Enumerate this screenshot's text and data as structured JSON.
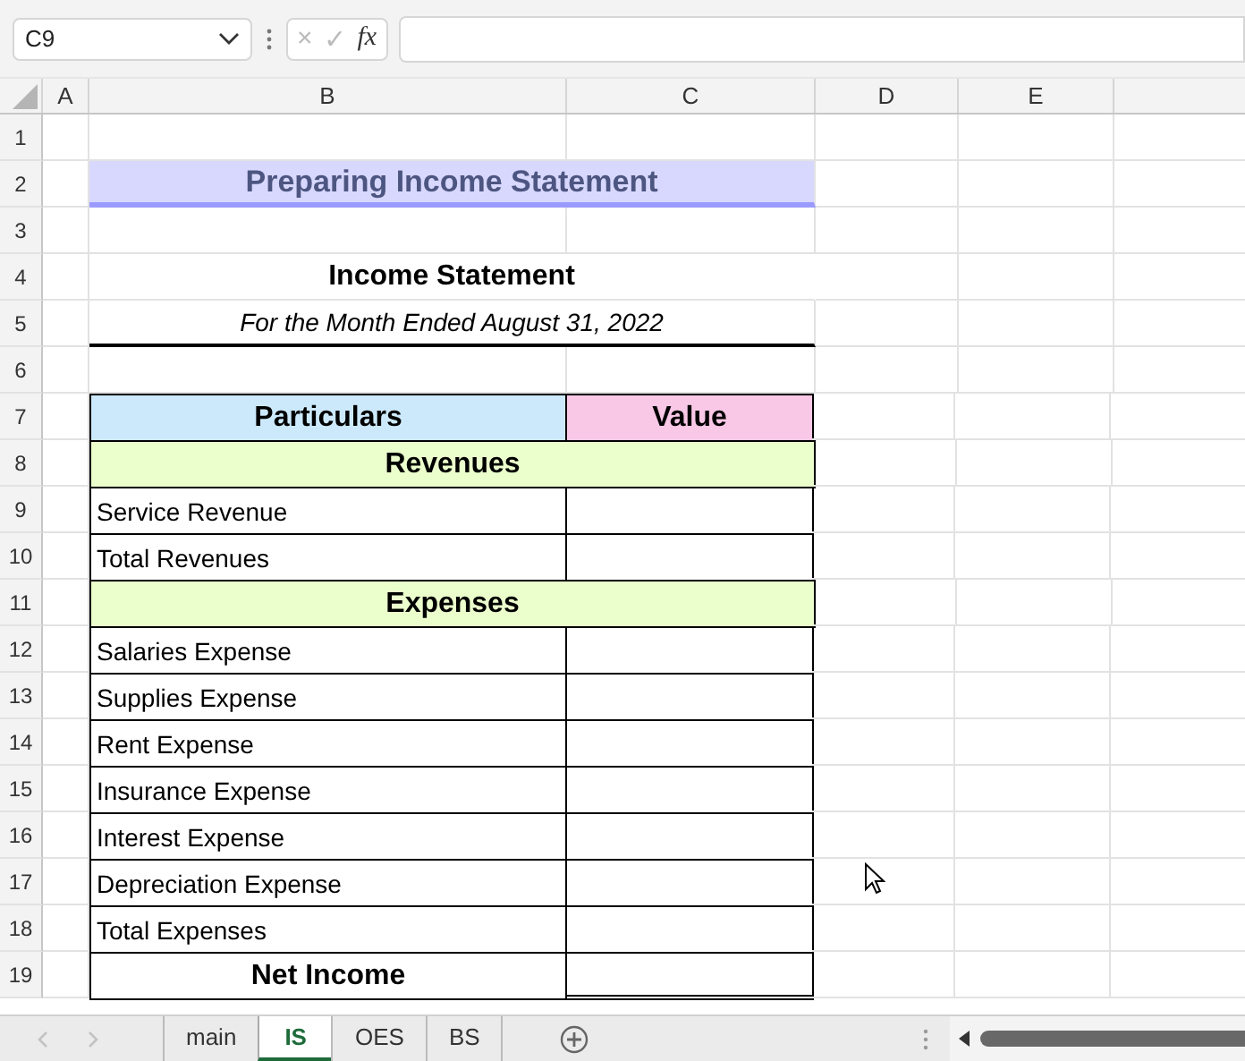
{
  "name_box": "C9",
  "formula_bar": {
    "cancel": "×",
    "enter": "✓",
    "function": "fx"
  },
  "columns": [
    "A",
    "B",
    "C",
    "D",
    "E"
  ],
  "rows": [
    {
      "row": "1",
      "kind": "blank"
    },
    {
      "row": "2",
      "kind": "title",
      "text": "Preparing Income Statement"
    },
    {
      "row": "3",
      "kind": "blank"
    },
    {
      "row": "4",
      "kind": "heading",
      "text": "Income Statement"
    },
    {
      "row": "5",
      "kind": "subheading",
      "text": "For the Month Ended August 31, 2022"
    },
    {
      "row": "6",
      "kind": "blank"
    },
    {
      "row": "7",
      "kind": "table_header",
      "particulars": "Particulars",
      "value": "Value"
    },
    {
      "row": "8",
      "kind": "section",
      "text": "Revenues"
    },
    {
      "row": "9",
      "kind": "item",
      "text": "Service Revenue"
    },
    {
      "row": "10",
      "kind": "item",
      "text": "Total Revenues"
    },
    {
      "row": "11",
      "kind": "section",
      "text": "Expenses"
    },
    {
      "row": "12",
      "kind": "item",
      "text": "Salaries Expense"
    },
    {
      "row": "13",
      "kind": "item",
      "text": "Supplies Expense"
    },
    {
      "row": "14",
      "kind": "item",
      "text": "Rent Expense"
    },
    {
      "row": "15",
      "kind": "item",
      "text": "Insurance Expense"
    },
    {
      "row": "16",
      "kind": "item",
      "text": "Interest Expense"
    },
    {
      "row": "17",
      "kind": "item",
      "text": "Depreciation Expense"
    },
    {
      "row": "18",
      "kind": "item",
      "text": "Total Expenses"
    },
    {
      "row": "19",
      "kind": "net",
      "text": "Net Income"
    }
  ],
  "sheet_tabs": [
    {
      "label": "main",
      "selected": false
    },
    {
      "label": "IS",
      "selected": true
    },
    {
      "label": "OES",
      "selected": false
    },
    {
      "label": "BS",
      "selected": false
    }
  ]
}
